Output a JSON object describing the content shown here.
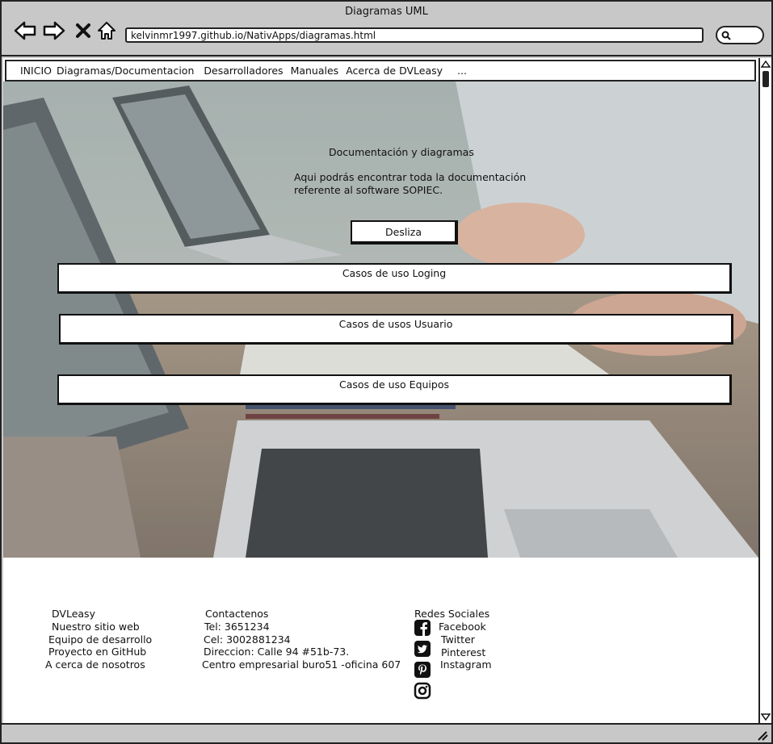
{
  "window": {
    "title": "Diagramas UML",
    "url": "kelvinmr1997.github.io/NativApps/diagramas.html"
  },
  "nav": {
    "items": [
      "INICIO",
      "Diagramas/Documentacion",
      "Desarrolladores",
      "Manuales",
      "Acerca de DVLeasy",
      "..."
    ]
  },
  "hero": {
    "title": "Documentación y diagramas",
    "text": "Aqui podrás encontrar toda la documentación referente al software SOPIEC.",
    "button": "Desliza"
  },
  "cases": [
    "Casos de uso Loging",
    "Casos de usos Usuario",
    "Casos de uso Equipos"
  ],
  "footer": {
    "col1": [
      "DVLeasy",
      "Nuestro sitio web",
      "Equipo de desarrollo",
      "Proyecto en GitHub",
      "A cerca de nosotros"
    ],
    "col2": [
      "Contactenos",
      "Tel: 3651234",
      "Cel: 3002881234",
      "Direccion: Calle 94 #51b-73.",
      "Centro empresarial buro51 -oficina 607"
    ],
    "social_title": "Redes Sociales",
    "social": [
      {
        "label": "Facebook",
        "icon": "facebook-icon"
      },
      {
        "label": "Twitter",
        "icon": "twitter-icon"
      },
      {
        "label": "Pinterest",
        "icon": "pinterest-icon"
      },
      {
        "label": "Instagram",
        "icon": "instagram-icon"
      }
    ]
  },
  "colors": {
    "chrome": "#c8c8c8",
    "stroke": "#222222"
  }
}
